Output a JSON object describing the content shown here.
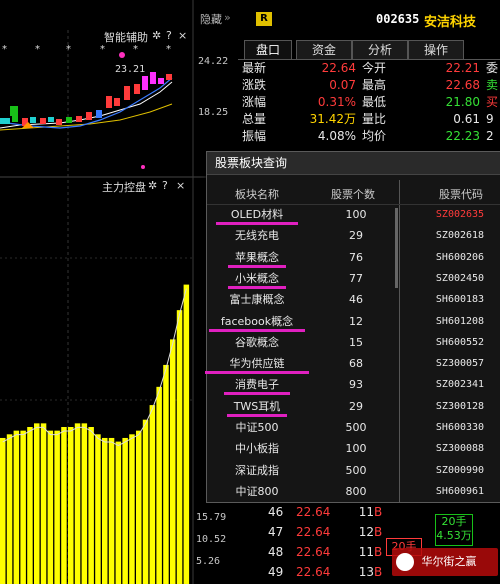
{
  "chart": {
    "assist_title": "智能辅助",
    "hide_label": "隐藏",
    "panel2_title": "主力控盘",
    "price_label_top": "23.21",
    "y_labels_top": [
      "24.22",
      "18.25"
    ],
    "y_labels_bottom": [
      "15.79",
      "10.52",
      "5.26"
    ],
    "bars": [
      0.4,
      0.41,
      0.42,
      0.42,
      0.43,
      0.44,
      0.44,
      0.42,
      0.42,
      0.43,
      0.43,
      0.44,
      0.44,
      0.43,
      0.41,
      0.4,
      0.4,
      0.39,
      0.4,
      0.41,
      0.42,
      0.45,
      0.49,
      0.54,
      0.6,
      0.67,
      0.75,
      0.82
    ]
  },
  "quote": {
    "badge": "R",
    "code": "002635",
    "name": "安洁科技",
    "tabs": [
      "盘口",
      "资金",
      "分析",
      "操作"
    ],
    "rows": [
      {
        "l1": "最新",
        "v1": "22.64",
        "c1": "red",
        "l2": "今开",
        "v2": "22.21",
        "c2": "red",
        "e": "委",
        "ce": "white"
      },
      {
        "l1": "涨跌",
        "v1": "0.07",
        "c1": "red",
        "l2": "最高",
        "v2": "22.68",
        "c2": "red",
        "e": "卖",
        "ce": "green"
      },
      {
        "l1": "涨幅",
        "v1": "0.31%",
        "c1": "red",
        "l2": "最低",
        "v2": "21.80",
        "c2": "green",
        "e": "买",
        "ce": "red"
      },
      {
        "l1": "总量",
        "v1": "31.42万",
        "c1": "yellow",
        "l2": "量比",
        "v2": "0.61",
        "c2": "white",
        "e": "9",
        "ce": "white"
      },
      {
        "l1": "振幅",
        "v1": "4.08%",
        "c1": "white",
        "l2": "均价",
        "v2": "22.23",
        "c2": "green",
        "e": "2",
        "ce": "white"
      }
    ],
    "trade_rows": [
      {
        "t": "46",
        "p": "22.64",
        "v": "11",
        "f": "B"
      },
      {
        "t": "47",
        "p": "22.64",
        "v": "12",
        "f": "B"
      },
      {
        "t": "48",
        "p": "22.64",
        "v": "11",
        "f": "B"
      },
      {
        "t": "49",
        "p": "22.64",
        "v": "13",
        "f": "B"
      }
    ],
    "side_box1": "20手",
    "side_box2": "4.53万",
    "side_box3": "20手"
  },
  "dialog": {
    "title": "股票板块查询",
    "headers": [
      "板块名称",
      "股票个数",
      "股票代码"
    ],
    "rows": [
      {
        "name": "OLED材料",
        "count": "100",
        "code": "SZ002635"
      },
      {
        "name": "无线充电",
        "count": "29",
        "code": "SZ002618"
      },
      {
        "name": "苹果概念",
        "count": "76",
        "code": "SH600206"
      },
      {
        "name": "小米概念",
        "count": "77",
        "code": "SZ002450"
      },
      {
        "name": "富士康概念",
        "count": "46",
        "code": "SH600183"
      },
      {
        "name": "facebook概念",
        "count": "12",
        "code": "SH601208"
      },
      {
        "name": "谷歌概念",
        "count": "15",
        "code": "SH600552"
      },
      {
        "name": "华为供应链",
        "count": "68",
        "code": "SZ300057"
      },
      {
        "name": "消费电子",
        "count": "93",
        "code": "SZ002341"
      },
      {
        "name": "TWS耳机",
        "count": "29",
        "code": "SZ300128"
      },
      {
        "name": "中证500",
        "count": "500",
        "code": "SH600330"
      },
      {
        "name": "中小板指",
        "count": "100",
        "code": "SZ300088"
      },
      {
        "name": "深证成指",
        "count": "500",
        "code": "SZ000990"
      },
      {
        "name": "中证800",
        "count": "800",
        "code": "SH600961"
      }
    ]
  },
  "watermark": "华尔街之赢",
  "colors": {
    "up": "#ff3b3b",
    "down": "#35e035",
    "accent": "#e020c0",
    "bar": "#ffff00"
  }
}
